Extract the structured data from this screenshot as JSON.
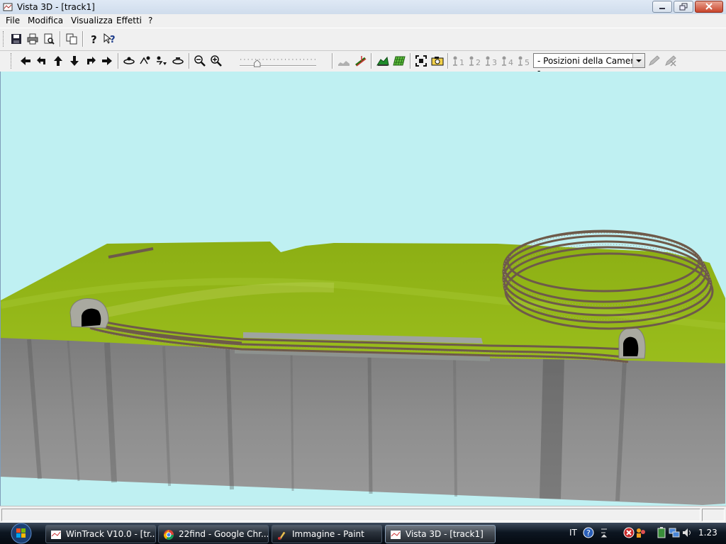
{
  "window": {
    "title": "Vista 3D - [track1]"
  },
  "menu": [
    "File",
    "Modifica",
    "Visualizza",
    "Effetti",
    "?"
  ],
  "toolbar1": {
    "buttons": [
      "save-icon",
      "print-icon",
      "print-preview-icon",
      "copy-icon",
      "help-icon",
      "context-help-icon"
    ]
  },
  "toolbar2": {
    "nav_buttons": [
      "arrow-left-icon",
      "turn-left-icon",
      "arrow-up-icon",
      "arrow-down-icon",
      "turn-right-icon",
      "arrow-right-icon"
    ],
    "camera_buttons": [
      "camera-orbit-icon",
      "camera-up-icon",
      "camera-down-icon",
      "camera-reset-icon"
    ],
    "zoom_buttons": [
      "zoom-out-icon",
      "zoom-in-icon"
    ],
    "zoom_slider_level": 0.22,
    "camera_positions": [
      "1",
      "2",
      "3",
      "4",
      "5"
    ],
    "camera_select": "- Posizioni della Camera -"
  },
  "scene": {
    "sky_color": "#bff0f2",
    "grass_color": "#8fb117",
    "base_color": "#8a8a8a",
    "track_color": "#6e5a4a"
  },
  "taskbar": {
    "tasks": [
      {
        "label": "WinTrack  V10.0 - [tr...",
        "icon": "wintrack-icon",
        "active": false
      },
      {
        "label": "22find - Google Chr...",
        "icon": "chrome-icon",
        "active": false
      },
      {
        "label": "Immagine - Paint",
        "icon": "paint-icon",
        "active": false
      },
      {
        "label": "Vista 3D - [track1]",
        "icon": "vista3d-icon",
        "active": true
      }
    ],
    "tray": {
      "language": "IT",
      "clock": "1.23"
    }
  }
}
